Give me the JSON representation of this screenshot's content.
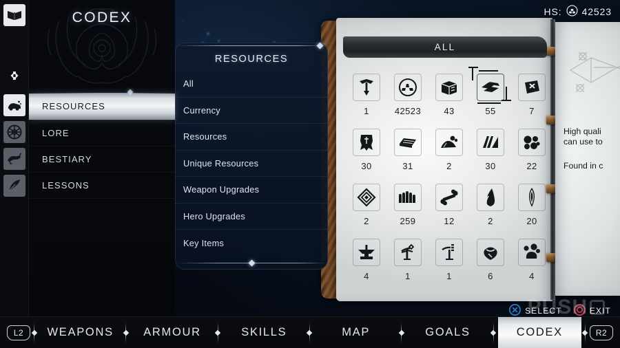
{
  "header": {
    "hs_label": "HS:",
    "hs_value": "42523",
    "hs_icon": "shards-icon"
  },
  "rail": {
    "items": [
      {
        "icon": "open-book-icon",
        "state": "active"
      },
      {
        "icon": "dpad-icon",
        "state": "plain"
      },
      {
        "icon": "resources-icon",
        "state": "active"
      },
      {
        "icon": "lore-tree-icon",
        "state": "dim"
      },
      {
        "icon": "bestiary-beast-icon",
        "state": "dim"
      },
      {
        "icon": "lessons-feather-icon",
        "state": "dim"
      }
    ]
  },
  "codex": {
    "title": "CODEX",
    "items": [
      {
        "label": "RESOURCES",
        "selected": true
      },
      {
        "label": "LORE",
        "selected": false
      },
      {
        "label": "BESTIARY",
        "selected": false
      },
      {
        "label": "LESSONS",
        "selected": false
      }
    ]
  },
  "subcategories": {
    "header": "RESOURCES",
    "items": [
      {
        "label": "All"
      },
      {
        "label": "Currency"
      },
      {
        "label": "Resources"
      },
      {
        "label": "Unique Resources"
      },
      {
        "label": "Weapon Upgrades"
      },
      {
        "label": "Hero Upgrades"
      },
      {
        "label": "Key Items"
      }
    ]
  },
  "book": {
    "banner": "ALL",
    "grid": [
      {
        "icon": "spike-arrow-icon",
        "qty": "1",
        "selected": false
      },
      {
        "icon": "shards-circle-icon",
        "qty": "42523",
        "selected": false
      },
      {
        "icon": "crate-icon",
        "qty": "43",
        "selected": false
      },
      {
        "icon": "metal-shards-icon",
        "qty": "55",
        "selected": true
      },
      {
        "icon": "marked-book-icon",
        "qty": "7",
        "selected": false
      },
      {
        "icon": "hide-pelt-icon",
        "qty": "30",
        "selected": false
      },
      {
        "icon": "ingot-bar-icon",
        "qty": "31",
        "selected": false
      },
      {
        "icon": "ore-pile-icon",
        "qty": "2",
        "selected": false
      },
      {
        "icon": "leather-strips-icon",
        "qty": "30",
        "selected": false
      },
      {
        "icon": "stone-cluster-icon",
        "qty": "22",
        "selected": false
      },
      {
        "icon": "rune-diamond-icon",
        "qty": "2",
        "selected": false
      },
      {
        "icon": "coin-stack-icon",
        "qty": "259",
        "selected": false
      },
      {
        "icon": "bone-icon",
        "qty": "12",
        "selected": false
      },
      {
        "icon": "flame-shard-icon",
        "qty": "2",
        "selected": false
      },
      {
        "icon": "gem-crystal-icon",
        "qty": "20",
        "selected": false
      },
      {
        "icon": "anvil-icon",
        "qty": "4",
        "selected": false
      },
      {
        "icon": "charm-totem-icon",
        "qty": "1",
        "selected": false
      },
      {
        "icon": "ritual-staff-icon",
        "qty": "1",
        "selected": false
      },
      {
        "icon": "pouch-icon",
        "qty": "6",
        "selected": false
      },
      {
        "icon": "ore-chunks-icon",
        "qty": "4",
        "selected": false
      }
    ],
    "detail": {
      "sketch_icon": "weapon-sketch-icon",
      "paragraphs": [
        "High quali",
        "can use to",
        "Found in c"
      ]
    }
  },
  "prompts": [
    {
      "button": "cross-button-icon",
      "label": "SELECT",
      "color": "#2a7fd4"
    },
    {
      "button": "circle-button-icon",
      "label": "EXIT",
      "color": "#d23c52"
    }
  ],
  "bottom_nav": {
    "left_shoulder": "L2",
    "right_shoulder": "R2",
    "tabs": [
      {
        "label": "WEAPONS",
        "active": false
      },
      {
        "label": "ARMOUR",
        "active": false
      },
      {
        "label": "SKILLS",
        "active": false
      },
      {
        "label": "MAP",
        "active": false
      },
      {
        "label": "GOALS",
        "active": false
      },
      {
        "label": "CODEX",
        "active": true
      }
    ]
  },
  "watermark": {
    "text": "PUSH"
  },
  "colors": {
    "accent_blue": "#2a7fd4",
    "accent_red": "#d23c52",
    "page_paper": "#eceeee",
    "leather": "#7a4f2c"
  }
}
